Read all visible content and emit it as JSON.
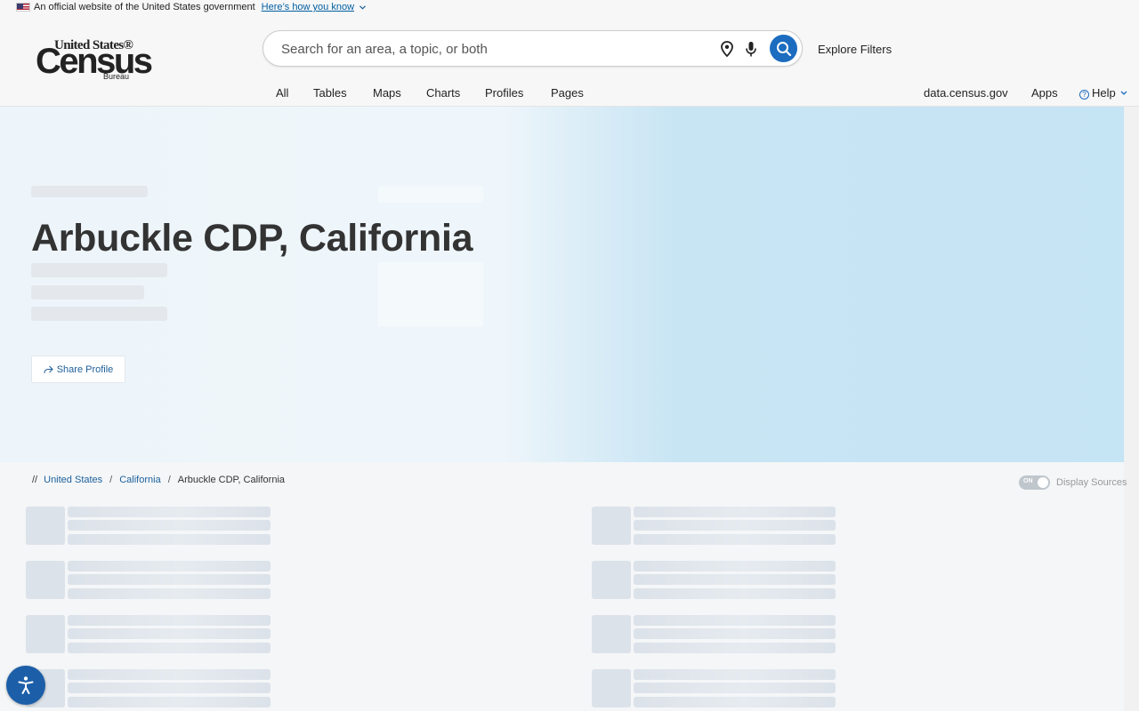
{
  "gov_banner": {
    "text": "An official website of the United States government",
    "link": "Here’s how you know"
  },
  "logo": {
    "line1": "United States®",
    "line2": "Census",
    "line3": "Bureau"
  },
  "search": {
    "placeholder": "Search for an area, a topic, or both"
  },
  "header": {
    "explore_filters": "Explore Filters",
    "tabs": [
      "All",
      "Tables",
      "Maps",
      "Charts",
      "Profiles",
      "Pages"
    ],
    "right_links": [
      "data.census.gov",
      "Apps",
      "Help"
    ]
  },
  "hero": {
    "title": "Arbuckle CDP, California",
    "share_label": "Share Profile"
  },
  "breadcrumb": {
    "prefix": "//",
    "items": [
      "United States",
      "California",
      "Arbuckle CDP, California"
    ]
  },
  "display_sources": {
    "toggle_text": "ON",
    "label": "Display Sources"
  },
  "colors": {
    "primary": "#1c6cc0",
    "link": "#1c5f9a",
    "title": "#333333",
    "hero_blue": "#c5e4f4"
  },
  "icons": [
    "us-flag-icon",
    "chevron-down-icon",
    "location-pin-icon",
    "microphone-icon",
    "search-icon",
    "help-icon",
    "share-icon",
    "accessibility-icon"
  ]
}
